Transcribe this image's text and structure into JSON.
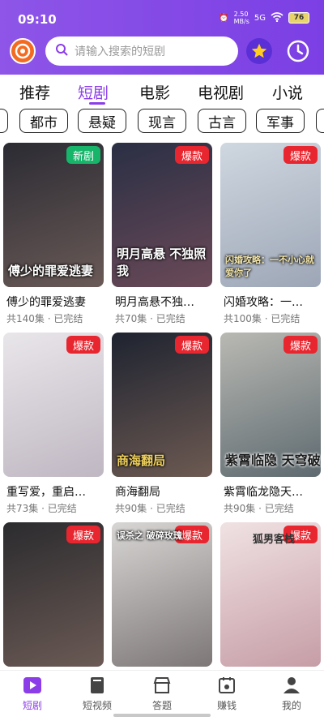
{
  "status": {
    "time": "09:10",
    "speed": "2.50",
    "speed_unit": "MB/s",
    "network": "5G",
    "battery": "76"
  },
  "search": {
    "placeholder": "请输入搜索的短剧"
  },
  "categories": [
    {
      "label": "推荐",
      "active": false
    },
    {
      "label": "短剧",
      "active": true
    },
    {
      "label": "电影",
      "active": false
    },
    {
      "label": "电视剧",
      "active": false
    },
    {
      "label": "小说",
      "active": false
    }
  ],
  "chips": [
    "都市",
    "悬疑",
    "现言",
    "古言",
    "军事"
  ],
  "dramas": [
    {
      "title": "傅少的罪爱逃妻",
      "meta": "共140集 · 已完结",
      "badge": "新剧",
      "badge_color": "#16b56a",
      "poster_text": "傅少的罪爱逃妻",
      "colors": [
        "#2b2b33",
        "#6a5a57"
      ]
    },
    {
      "title": "明月高悬不独…",
      "meta": "共70集 · 已完结",
      "badge": "爆款",
      "badge_color": "#e8262f",
      "poster_text": "明月高悬 不独照我",
      "colors": [
        "#2a2f44",
        "#6b4a58"
      ]
    },
    {
      "title": "闪婚攻略：一…",
      "meta": "共100集 · 已完结",
      "badge": "爆款",
      "badge_color": "#e8262f",
      "poster_text": "闪婚攻略：一不小心就爱你了",
      "colors": [
        "#cfd7e0",
        "#9da6b6"
      ]
    },
    {
      "title": "重写爱，重启…",
      "meta": "共73集 · 已完结",
      "badge": "爆款",
      "badge_color": "#e8262f",
      "poster_text": "",
      "colors": [
        "#e9e6ea",
        "#bfb7c2"
      ]
    },
    {
      "title": "商海翻局",
      "meta": "共90集 · 已完结",
      "badge": "爆款",
      "badge_color": "#e8262f",
      "poster_text": "商海翻局",
      "colors": [
        "#1e2330",
        "#6d5a52"
      ]
    },
    {
      "title": "紫霄临龙隐天…",
      "meta": "共90集 · 已完结",
      "badge": "爆款",
      "badge_color": "#e8262f",
      "poster_text": "紫霄临隐 天穹破",
      "colors": [
        "#b9b9b3",
        "#5e6a70"
      ]
    },
    {
      "title": "",
      "meta": "",
      "badge": "爆款",
      "badge_color": "#e8262f",
      "poster_text": "",
      "colors": [
        "#2b2b2e",
        "#6b5a55"
      ]
    },
    {
      "title": "",
      "meta": "",
      "badge": "爆款",
      "badge_color": "#e8262f",
      "poster_text": "误杀之 破碎玫瑰",
      "colors": [
        "#d8d6d4",
        "#7d7777"
      ]
    },
    {
      "title": "",
      "meta": "",
      "badge": "爆款",
      "badge_color": "#e8262f",
      "poster_text": "狐男客栈",
      "colors": [
        "#f0e2e3",
        "#c69da6"
      ]
    }
  ],
  "nav": [
    {
      "label": "短剧",
      "icon": "play-icon",
      "active": true
    },
    {
      "label": "短视频",
      "icon": "video-book-icon",
      "active": false
    },
    {
      "label": "答题",
      "icon": "store-icon",
      "active": false
    },
    {
      "label": "赚钱",
      "icon": "calendar-coin-icon",
      "active": false
    },
    {
      "label": "我的",
      "icon": "user-icon",
      "active": false
    }
  ],
  "accent": "#8b3de8"
}
